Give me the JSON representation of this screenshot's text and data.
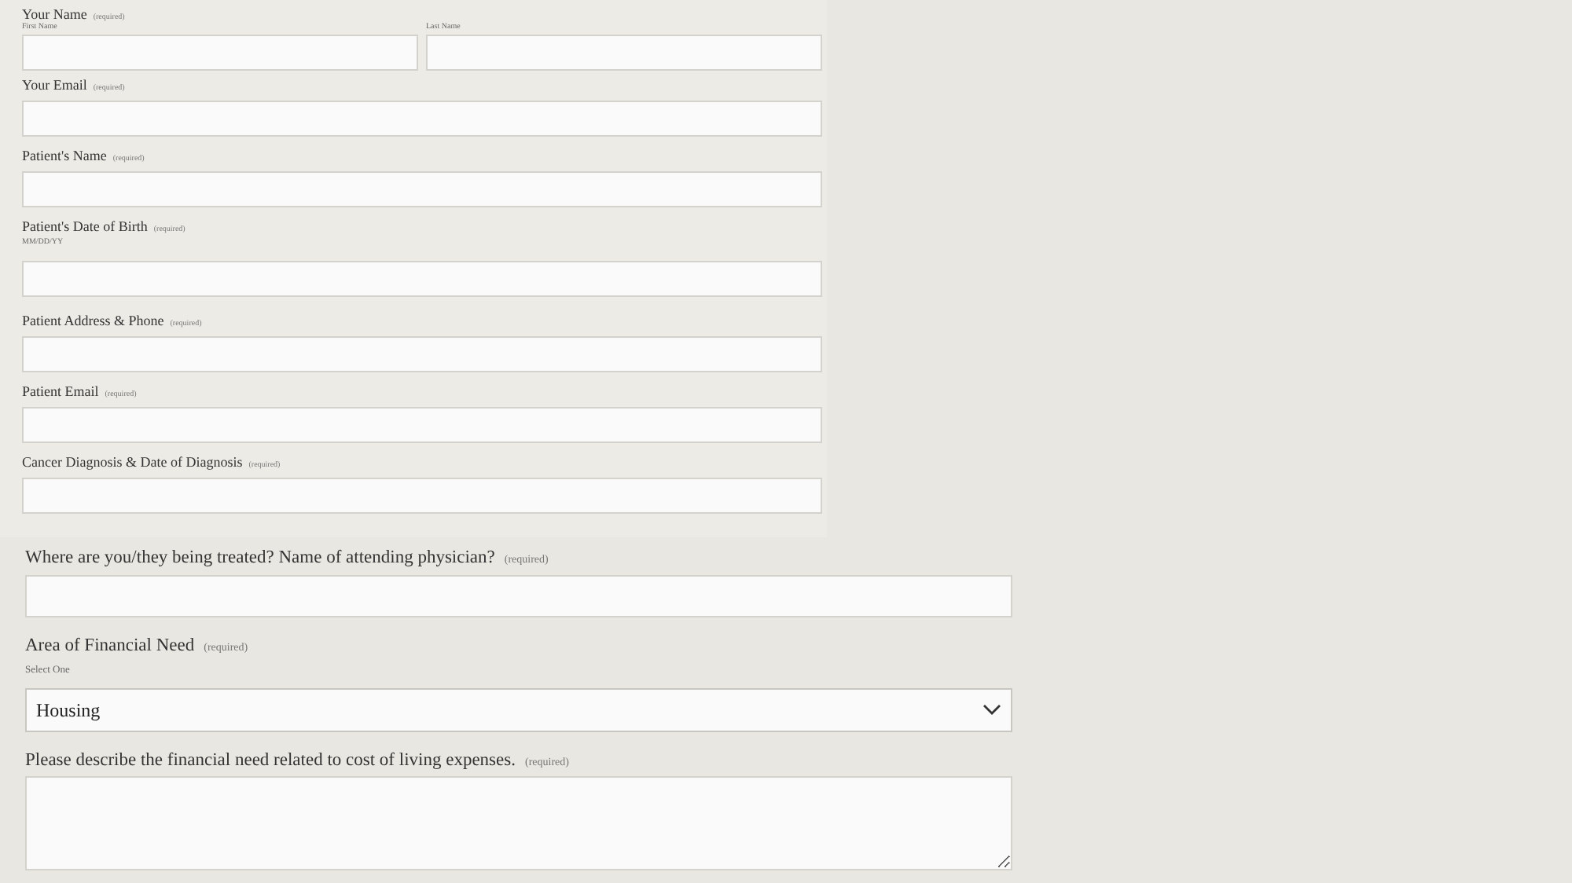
{
  "top_section": {
    "fields": [
      {
        "kind": "name_pair",
        "label": "Your Name",
        "required": "(required)",
        "parts": [
          {
            "sublabel": "First Name"
          },
          {
            "sublabel": "Last Name"
          }
        ]
      },
      {
        "kind": "text",
        "label": "Your Email",
        "required": "(required)"
      },
      {
        "kind": "text",
        "label": "Patient's Name",
        "required": "(required)"
      },
      {
        "kind": "text",
        "label": "Patient's Date of Birth",
        "required": "(required)",
        "hint": "MM/DD/YY"
      },
      {
        "kind": "text",
        "label": "Patient Address & Phone",
        "required": "(required)"
      },
      {
        "kind": "text",
        "label": "Patient Email",
        "required": "(required)"
      },
      {
        "kind": "text",
        "label": "Cancer Diagnosis & Date of Diagnosis",
        "required": "(required)"
      }
    ]
  },
  "bottom_section": {
    "fields": [
      {
        "kind": "text",
        "label": "Where are you/they being treated? Name of attending physician?",
        "required": "(required)"
      },
      {
        "kind": "select",
        "label": "Area of Financial Need",
        "required": "(required)",
        "hint": "Select One",
        "value": "Housing"
      },
      {
        "kind": "textarea",
        "label": "Please describe the financial need related to cost of living expenses.",
        "required": "(required)"
      }
    ]
  }
}
